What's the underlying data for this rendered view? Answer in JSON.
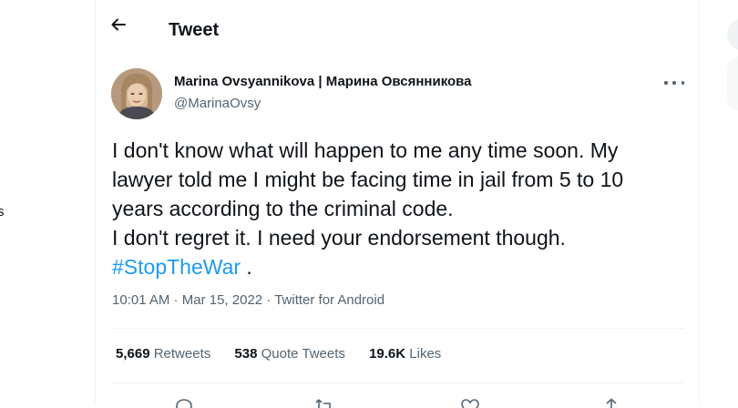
{
  "left_nav": {
    "clipped_text": "s"
  },
  "header": {
    "title": "Tweet",
    "back_icon": "arrow-left-icon"
  },
  "tweet": {
    "author": {
      "display_name": "Marina Ovsyannikova | Марина Овсянникова",
      "handle": "@MarinaOvsy"
    },
    "text_lines": [
      "I don't know what will happen to me any time soon. My",
      "lawyer told me I might be facing time in jail from 5 to 10",
      "years according to the criminal code.",
      "I don't regret it. I need your endorsement though."
    ],
    "hashtag": "#StopTheWar",
    "hashtag_suffix": " .",
    "time": "10:01 AM",
    "date": "Mar 15, 2022",
    "source": "Twitter for Android",
    "separator": " · ",
    "stats": {
      "retweets": {
        "count": "5,669",
        "label": "Retweets"
      },
      "quotes": {
        "count": "538",
        "label": "Quote Tweets"
      },
      "likes": {
        "count": "19.6K",
        "label": "Likes"
      }
    },
    "actions": [
      "reply-icon",
      "retweet-icon",
      "like-icon",
      "share-icon"
    ]
  },
  "colors": {
    "accent": "#1d9bf0",
    "text_primary": "#0f1419",
    "text_secondary": "#536471",
    "divider": "#eff3f4"
  }
}
